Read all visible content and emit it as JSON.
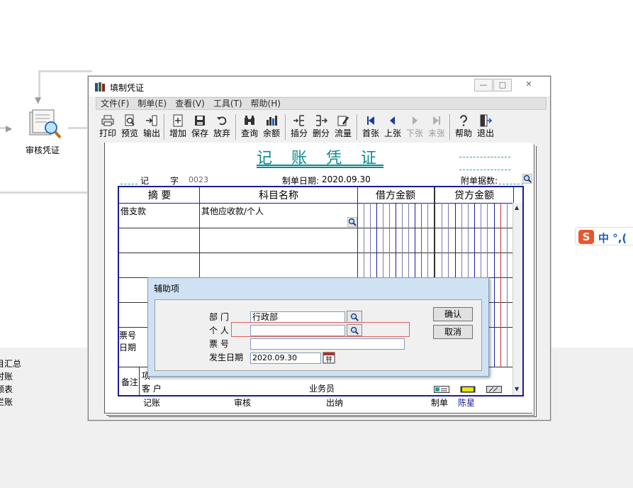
{
  "background": {
    "flow_label": "审核凭证",
    "left_menu": [
      "目汇总",
      "时账",
      "额表",
      "栏账"
    ]
  },
  "window": {
    "title": "填制凭证",
    "controls": {
      "minimize": "—",
      "maximize": "□",
      "close": "✕"
    }
  },
  "menu": [
    "文件(F)",
    "制单(E)",
    "查看(V)",
    "工具(T)",
    "帮助(H)"
  ],
  "toolbar": {
    "print": "打印",
    "preview": "预览",
    "output": "输出",
    "add": "增加",
    "save": "保存",
    "discard": "放弃",
    "query": "查询",
    "balance": "余额",
    "insert": "插分",
    "delete": "删分",
    "flow": "流量",
    "first": "首张",
    "prev": "上张",
    "next": "下张",
    "last": "末张",
    "help": "帮助",
    "exit": "退出"
  },
  "voucher": {
    "title": "记 账 凭 证",
    "type_label": "记",
    "zi_label": "字",
    "number": "0023",
    "date_label": "制单日期:",
    "date_value": "2020.09.30",
    "attachments_label": "附单据数:",
    "headers": {
      "summary": "摘  要",
      "account": "科目名称",
      "debit": "借方金额",
      "credit": "贷方金额"
    },
    "rows": [
      {
        "summary": "借支款",
        "account": "其他应收款/个人"
      }
    ],
    "bill_no_label": "票号",
    "date_row_label": "日期",
    "remark_label": "备注",
    "item_label": "项",
    "customer_label": "客  户",
    "salesperson_label": "业务员",
    "footer": {
      "bookkeeping": "记账",
      "review": "审核",
      "cashier": "出纳",
      "maker_label": "制单",
      "maker_name": "陈星"
    }
  },
  "dialog": {
    "title": "辅助项",
    "department_label": "部    门",
    "department_value": "行政部",
    "person_label": "个    人",
    "person_value": "",
    "bill_label": "票    号",
    "bill_value": "",
    "date_label": "发生日期",
    "date_value": "2020.09.30",
    "ok": "确认",
    "cancel": "取消"
  },
  "ime": {
    "logo": "S",
    "text": "中 °,("
  }
}
